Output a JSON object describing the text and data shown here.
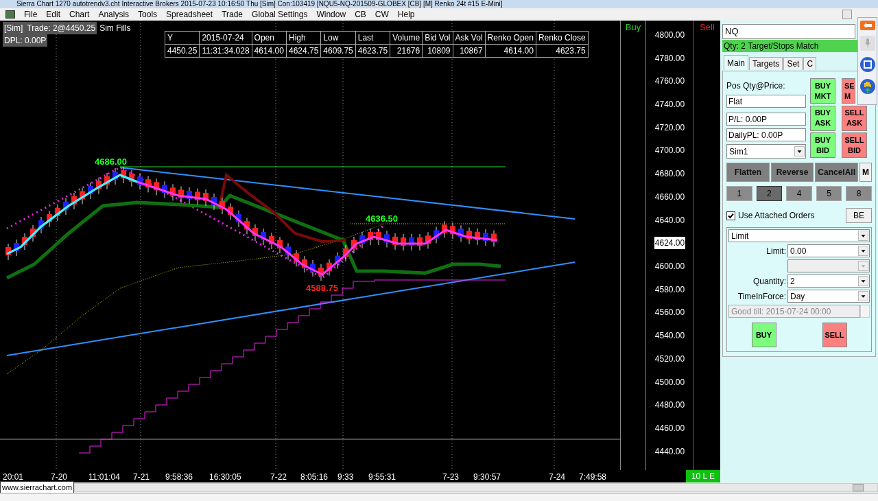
{
  "title_bar": {
    "title": "Sierra Chart 1270 autotrendv3.cht  Interactive Brokers 2015-07-23  10:16:50 Thu [Sim]  Con:103419    [NQU5-NQ-201509-GLOBEX [CB] [M]  Renko 24t  #15  E-Mini]"
  },
  "menu": [
    "File",
    "Edit",
    "Chart",
    "Analysis",
    "Tools",
    "Spreadsheet",
    "Trade",
    "Global Settings",
    "Window",
    "CB",
    "CW",
    "Help"
  ],
  "chart": {
    "trade_info": {
      "account": "[Sim]",
      "trade": "Trade: 2@4450.25",
      "fills": "Sim Fills",
      "dpl": "DPL: 0.00P"
    },
    "data_table": {
      "columns": [
        "Y",
        "2015-07-24",
        "Open",
        "High",
        "Low",
        "Last",
        "Volume",
        "Bid Vol",
        "Ask Vol",
        "Renko Open",
        "Renko Close"
      ],
      "row": [
        "4450.25",
        "11:31:34.028",
        "4614.00",
        "4624.75",
        "4609.75",
        "4623.75",
        "21676",
        "10809",
        "10867",
        "4614.00",
        "4623.75"
      ]
    },
    "annotations": [
      {
        "text": "4686.00",
        "kind": "high"
      },
      {
        "text": "4636.50",
        "kind": "high"
      },
      {
        "text": "4588.75",
        "kind": "low"
      }
    ],
    "buy_label": "Buy",
    "sell_label": "Sell",
    "price_axis": [
      {
        "label": "4800.00",
        "kind": "tick"
      },
      {
        "label": "4780.00",
        "kind": "tick"
      },
      {
        "label": "4760.00",
        "kind": "tick"
      },
      {
        "label": "4740.00",
        "kind": "tick"
      },
      {
        "label": "4720.00",
        "kind": "tick"
      },
      {
        "label": "4700.00",
        "kind": "tick"
      },
      {
        "label": "4680.00",
        "kind": "tick"
      },
      {
        "label": "4660.00",
        "kind": "tick"
      },
      {
        "label": "4640.00",
        "kind": "tick"
      },
      {
        "label": "4624.00",
        "kind": "current"
      },
      {
        "label": "4600.00",
        "kind": "tick"
      },
      {
        "label": "4580.00",
        "kind": "tick"
      },
      {
        "label": "4560.00",
        "kind": "tick"
      },
      {
        "label": "4540.00",
        "kind": "tick"
      },
      {
        "label": "4520.00",
        "kind": "tick"
      },
      {
        "label": "4500.00",
        "kind": "tick"
      },
      {
        "label": "4480.00",
        "kind": "tick"
      },
      {
        "label": "4460.00",
        "kind": "tick"
      },
      {
        "label": "4440.00",
        "kind": "tick"
      }
    ],
    "time_axis": [
      "20:01",
      "7-20",
      "11:01:04",
      "7-21",
      "9:58:36",
      "16:30:05",
      "7-22",
      "8:05:16",
      "9:33",
      "9:55:31",
      "7-23",
      "9:30:57",
      "7-24",
      "7:49:58"
    ],
    "status_badge": "10 L E"
  },
  "footer": {
    "link": "www.sierrachart.com"
  },
  "trade_panel": {
    "symbol": "NQ",
    "status": "Qty: 2 Target/Stops Match",
    "tabs": [
      {
        "label": "Main",
        "selected": true
      },
      {
        "label": "Targets",
        "selected": false
      },
      {
        "label": "Set",
        "selected": false
      },
      {
        "label": "C",
        "selected": false
      }
    ],
    "pos_label": "Pos Qty@Price:",
    "position": "Flat",
    "pl": "P/L: 0.00P",
    "daily_pl": "DailyPL: 0.00P",
    "account": "Sim1",
    "order_buttons": [
      {
        "lines": [
          "BUY",
          "MKT"
        ],
        "kind": "buy"
      },
      {
        "lines": [
          "SE",
          "M"
        ],
        "kind": "sell_partial"
      },
      {
        "lines": [
          "BUY",
          "ASK"
        ],
        "kind": "buy"
      },
      {
        "lines": [
          "SELL",
          "ASK"
        ],
        "kind": "sell"
      },
      {
        "lines": [
          "BUY",
          "BID"
        ],
        "kind": "buy"
      },
      {
        "lines": [
          "SELL",
          "BID"
        ],
        "kind": "sell"
      }
    ],
    "quick_buttons": [
      "Flatten",
      "Reverse",
      "CancelAll",
      "M"
    ],
    "quantity_presets": [
      {
        "label": "1",
        "selected": false
      },
      {
        "label": "2",
        "selected": true
      },
      {
        "label": "4",
        "selected": false
      },
      {
        "label": "5",
        "selected": false
      },
      {
        "label": "8",
        "selected": false
      }
    ],
    "attached_orders": {
      "label": "Use Attached Orders",
      "checked": true
    },
    "be_button": "BE",
    "order_type": "Limit",
    "limit": {
      "label": "Limit:",
      "value": "0.00"
    },
    "quantity": {
      "label": "Quantity:",
      "value": "2"
    },
    "time_in_force": {
      "label": "TimeInForce:",
      "value": "Day"
    },
    "good_till": "Good till: 2015-07-24 00:00",
    "buy": "BUY",
    "sell": "SELL"
  }
}
